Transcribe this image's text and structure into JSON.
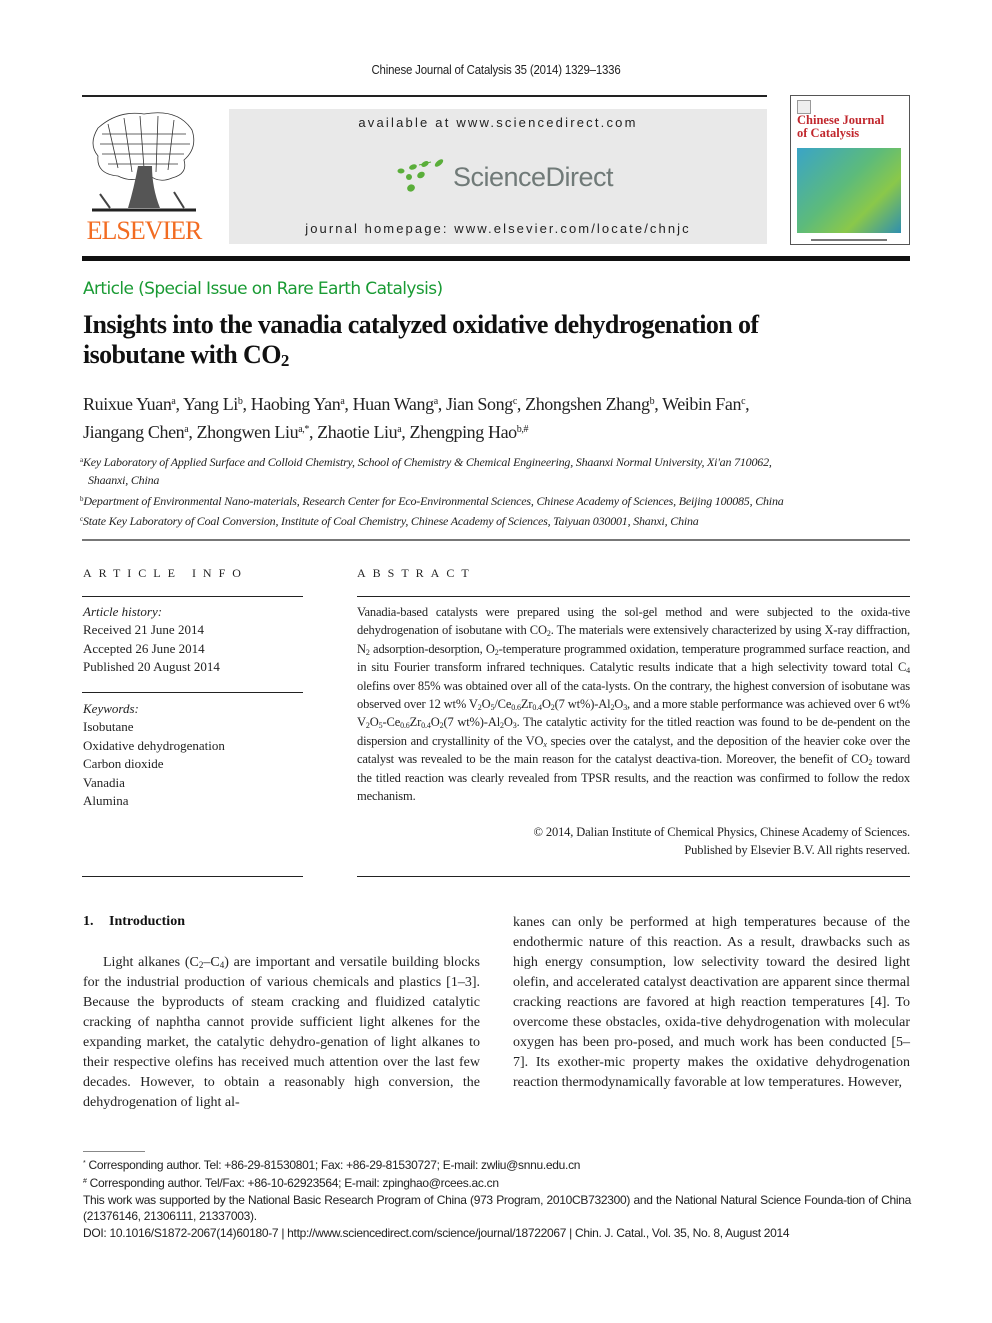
{
  "header": {
    "journal_ref": "Chinese Journal of Catalysis 35 (2014) 1329–1336",
    "publisher_logo_text": "ELSEVIER",
    "available_at": "available at www.sciencedirect.com",
    "sciencedirect_logo_text": "ScienceDirect",
    "homepage": "journal homepage: www.elsevier.com/locate/chnjc",
    "cover_title_line1": "Chinese Journal",
    "cover_title_line2": "of Catalysis",
    "colors": {
      "elsevier_orange": "#f26c22",
      "sciencedirect_green": "#5aae3a",
      "cover_red": "#c1272d"
    }
  },
  "article": {
    "section_tag": "Article (Special Issue on Rare Earth Catalysis)",
    "section_tag_color": "#1a9b34",
    "title_line1": "Insights into the vanadia catalyzed oxidative dehydrogenation of",
    "title_line2_prefix": "isobutane with CO",
    "title_line2_sub": "2",
    "authors": [
      {
        "name": "Ruixue Yuan",
        "aff": "a",
        "sep": ", "
      },
      {
        "name": "Yang Li",
        "aff": "b",
        "sep": ", "
      },
      {
        "name": "Haobing Yan",
        "aff": "a",
        "sep": ", "
      },
      {
        "name": "Huan Wang",
        "aff": "a",
        "sep": ", "
      },
      {
        "name": "Jian Song",
        "aff": "c",
        "sep": ", "
      },
      {
        "name": "Zhongshen Zhang",
        "aff": "b",
        "sep": ", "
      },
      {
        "name": "Weibin Fan",
        "aff": "c",
        "sep": ","
      },
      {
        "name": "Jiangang Chen",
        "aff": "a",
        "sep": ", "
      },
      {
        "name": "Zhongwen Liu",
        "aff": "a,*",
        "sep": ", "
      },
      {
        "name": "Zhaotie Liu",
        "aff": "a",
        "sep": ", "
      },
      {
        "name": "Zhengping Hao",
        "aff": "b,#",
        "sep": ""
      }
    ],
    "affiliations": [
      {
        "mark": "a",
        "line1": "Key Laboratory of Applied Surface and Colloid Chemistry, School of Chemistry & Chemical Engineering, Shaanxi Normal University, Xi'an 710062,",
        "line2": "Shaanxi, China"
      },
      {
        "mark": "b",
        "line1": "Department of Environmental Nano-materials, Research Center for Eco-Environmental Sciences, Chinese Academy of Sciences, Beijing 100085, China"
      },
      {
        "mark": "c",
        "line1": "State Key Laboratory of Coal Conversion, Institute of Coal Chemistry, Chinese Academy of Sciences, Taiyuan 030001, Shanxi, China"
      }
    ]
  },
  "article_info": {
    "heading": "ARTICLE INFO",
    "history_label": "Article history:",
    "history": [
      "Received 21 June 2014",
      "Accepted 26 June 2014",
      "Published 20 August 2014"
    ],
    "keywords_label": "Keywords:",
    "keywords": [
      "Isobutane",
      "Oxidative dehydrogenation",
      "Carbon dioxide",
      "Vanadia",
      "Alumina"
    ]
  },
  "abstract": {
    "heading": "ABSTRACT",
    "p1": "Vanadia-based catalysts were prepared using the sol-gel method and were subjected to the oxida-tive dehydrogenation of isobutane with CO",
    "p2": ". The materials were extensively characterized by using X-ray diffraction, N",
    "p3": " adsorption-desorption, O",
    "p4": "-temperature programmed oxidation, temperature programmed surface reaction, and in situ Fourier transform infrared techniques. Catalytic results indicate that a high selectivity toward total C",
    "p5": " olefins over 85% was obtained over all of the cata-lysts. On the contrary, the highest conversion of isobutane was observed over 12 wt% V",
    "p6": "O",
    "p7": "/Ce",
    "p8": "Zr",
    "p9": "O",
    "p10": "(7 wt%)-Al",
    "p11": "O",
    "p12": ", and a more stable performance was achieved over 6 wt% V",
    "p13": "(7 wt%)-Al",
    "p14": ". The catalytic activity for the titled reaction was found to be de-pendent on the dispersion and crystallinity of the VO",
    "p15": " species over the catalyst, and the deposition of the heavier coke over the catalyst was revealed to be the main reason for the catalyst deactiva-tion. Moreover, the benefit of CO",
    "p16": " toward the titled reaction was clearly revealed from TPSR results, and the reaction was confirmed to follow the redox mechanism.",
    "sub2": "2",
    "sub4": "4",
    "sub5": "5",
    "sub3": "3",
    "sub06": "0.6",
    "sub04": "0.4",
    "subx": "x",
    "dash": "-",
    "copyright_line1": "© 2014, Dalian Institute of Chemical Physics, Chinese Academy of Sciences.",
    "copyright_line2": "Published by Elsevier B.V. All rights reserved."
  },
  "introduction": {
    "number": "1.",
    "heading": "Introduction",
    "left_a": "Light alkanes (C",
    "left_sub2": "2",
    "left_b": "–C",
    "left_sub4": "4",
    "left_c": ") are important and versatile building blocks for the industrial production of various chemicals and plastics [1–3]. Because the byproducts of steam cracking and fluidized catalytic cracking of naphtha cannot provide sufficient light alkenes for the expanding market, the catalytic dehydro-genation of light alkanes to their respective olefins has received much attention over the last few decades. However, to obtain a reasonably high conversion, the dehydrogenation of light al-",
    "right": "kanes can only be performed at high temperatures because of the endothermic nature of this reaction. As a result, drawbacks such as high energy consumption, low selectivity toward the desired light olefin, and accelerated catalyst deactivation are apparent since thermal cracking reactions are favored at high reaction temperatures [4]. To overcome these obstacles, oxida-tive dehydrogenation with molecular oxygen has been pro-posed, and much work has been conducted [5–7]. Its exother-mic property makes the oxidative dehydrogenation reaction thermodynamically favorable at low temperatures. However,"
  },
  "footnotes": {
    "corr1_mark": "*",
    "corr1": "Corresponding author. Tel: +86-29-81530801; Fax: +86-29-81530727; E-mail: zwliu@snnu.edu.cn",
    "corr2_mark": "#",
    "corr2": "Corresponding author. Tel/Fax: +86-10-62923564; E-mail: zpinghao@rcees.ac.cn",
    "funding": "This work was supported by the National Basic Research Program of China (973 Program, 2010CB732300) and the National Natural Science Founda-tion of China (21376146, 21306111, 21337003).",
    "doi_line": "DOI: 10.1016/S1872-2067(14)60180-7 | http://www.sciencedirect.com/science/journal/18722067 | Chin. J. Catal., Vol. 35, No. 8, August 2014"
  }
}
